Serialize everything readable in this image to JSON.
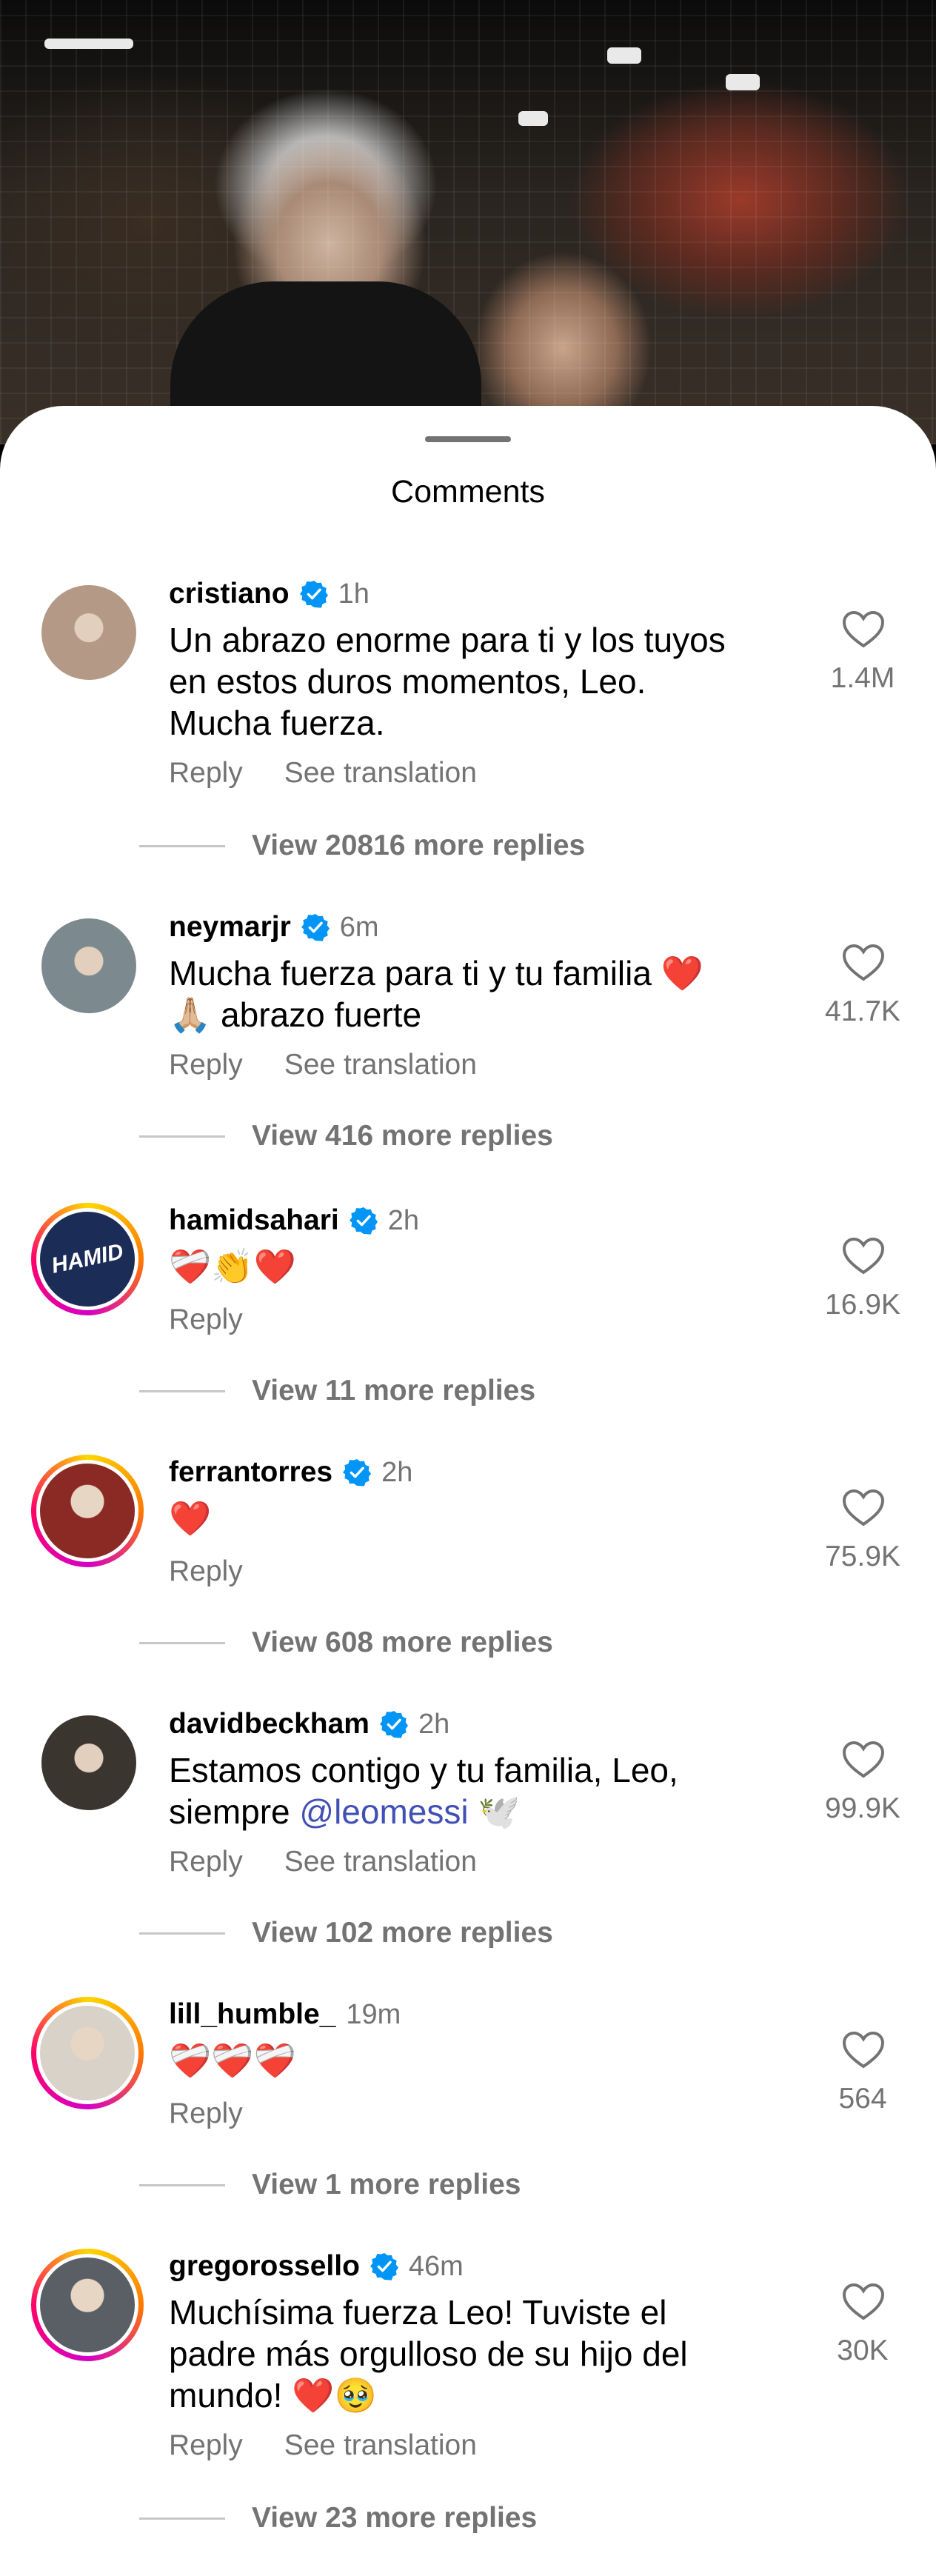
{
  "sheet_title": "Comments",
  "comments": [
    {
      "user": "cristiano",
      "verified": true,
      "time": "1h",
      "text_lines": [
        "Un abrazo enorme para ti y los tuyos",
        "en estos duros momentos, Leo.",
        "Mucha fuerza."
      ],
      "reply": "Reply",
      "translate": "See translation",
      "likes": "1.4M",
      "more": "View 20816 more replies",
      "avatar_color": "#b49a86"
    },
    {
      "user": "neymarjr",
      "verified": true,
      "time": "6m",
      "text_lines": [
        "Mucha fuerza para ti y tu familia ❤️",
        "🙏🏼 abrazo fuerte"
      ],
      "reply": "Reply",
      "translate": "See translation",
      "likes": "41.7K",
      "more": "View 416 more replies",
      "avatar_color": "#7c8a8f"
    },
    {
      "user": "hamidsahari",
      "verified": true,
      "time": "2h",
      "text_lines": [
        "❤️‍🩹👏❤️"
      ],
      "reply": "Reply",
      "likes": "16.9K",
      "more": "View 11 more replies",
      "avatar_color": "#1b2c57",
      "avatar_text": "HAMID"
    },
    {
      "user": "ferrantorres",
      "verified": true,
      "time": "2h",
      "text_lines": [
        "❤️"
      ],
      "reply": "Reply",
      "likes": "75.9K",
      "more": "View 608 more replies",
      "avatar_color": "#8b2a25"
    },
    {
      "user": "davidbeckham",
      "verified": true,
      "time": "2h",
      "text_before_mention": "siempre ",
      "mention": "@leomessi",
      "text_after_mention": " 🕊️",
      "text_lines": [
        "Estamos contigo y tu familia, Leo,"
      ],
      "reply": "Reply",
      "translate": "See translation",
      "likes": "99.9K",
      "more": "View 102 more replies",
      "avatar_color": "#3b3530"
    },
    {
      "user": "lill_humble_",
      "verified": false,
      "time": "19m",
      "text_lines": [
        "❤️‍🩹❤️‍🩹❤️‍🩹"
      ],
      "reply": "Reply",
      "likes": "564",
      "more": "View 1 more replies",
      "avatar_color": "#d9d2c8"
    },
    {
      "user": "gregorossello",
      "verified": true,
      "time": "46m",
      "text_lines": [
        "Muchísima fuerza Leo! Tuviste el",
        "padre más orgulloso de su hijo del",
        "mundo! ❤️🥹"
      ],
      "reply": "Reply",
      "translate": "See translation",
      "likes": "30K",
      "more": "View 23 more replies",
      "avatar_color": "#5a5f66"
    }
  ],
  "colors": {
    "verified": "#0095f6",
    "secondary": "#737373",
    "mention": "#4150b5"
  }
}
